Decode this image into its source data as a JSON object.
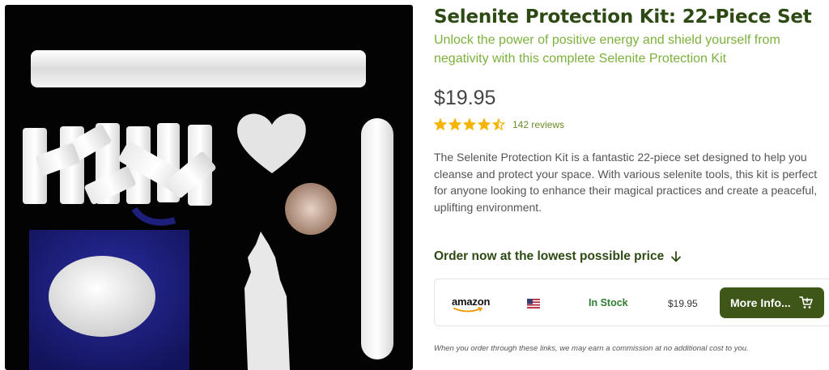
{
  "product": {
    "image_alt": "Selenite protection kit pieces on black background",
    "title": "Selenite Protection Kit: 22-Piece Set",
    "subtitle": "Unlock the power of positive energy and shield yourself from negativity with this complete Selenite Protection Kit",
    "price": "$19.95",
    "rating": 4.5,
    "reviews": "142 reviews",
    "description": "The Selenite Protection Kit is a fantastic 22-piece set designed to help you cleanse and protect your space. With various selenite tools, this kit is perfect for anyone looking to enhance their magical practices and create a peaceful, uplifting environment."
  },
  "order": {
    "heading": "Order now at the lowest possible price",
    "offers": [
      {
        "store": "amazon",
        "country_icon": "us-flag-icon",
        "stock": "In Stock",
        "price": "$19.95",
        "button_label": "More Info...",
        "button_icon": "cart-icon"
      }
    ]
  },
  "disclaimer": "When you order through these links, we may earn a commission at no additional cost to you.",
  "colors": {
    "title": "#2e4a14",
    "subtitle": "#7cb13c",
    "stars": "#f5b400",
    "button": "#3e5617",
    "stock": "#2f7d33"
  }
}
